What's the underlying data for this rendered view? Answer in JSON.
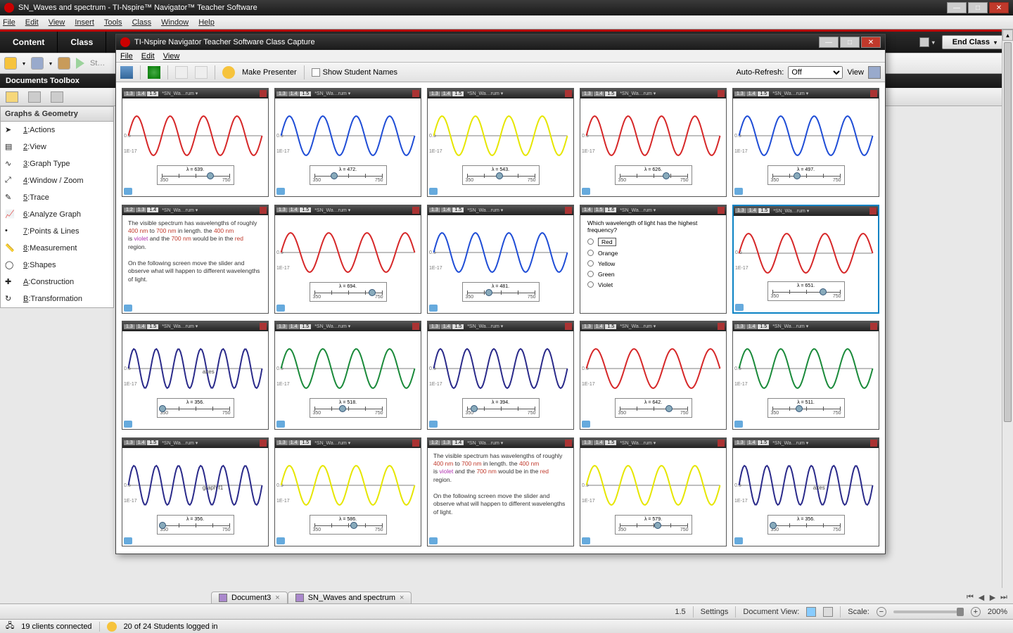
{
  "window": {
    "title": "SN_Waves and spectrum - TI-Nspire™ Navigator™ Teacher Software"
  },
  "menubar": [
    "File",
    "Edit",
    "View",
    "Insert",
    "Tools",
    "Class",
    "Window",
    "Help"
  ],
  "topTabs": [
    "Content",
    "Class"
  ],
  "endClass": "End Class",
  "docbar": "Documents Toolbox",
  "sidebar": {
    "header": "Graphs & Geometry",
    "items": [
      {
        "hot": "1",
        "label": ":Actions"
      },
      {
        "hot": "2",
        "label": ":View"
      },
      {
        "hot": "3",
        "label": ":Graph Type"
      },
      {
        "hot": "4",
        "label": ":Window / Zoom"
      },
      {
        "hot": "5",
        "label": ":Trace"
      },
      {
        "hot": "6",
        "label": ":Analyze Graph"
      },
      {
        "hot": "7",
        "label": ":Points & Lines"
      },
      {
        "hot": "8",
        "label": ":Measurement"
      },
      {
        "hot": "9",
        "label": ":Shapes"
      },
      {
        "hot": "A",
        "label": ":Construction"
      },
      {
        "hot": "B",
        "label": ":Transformation"
      }
    ]
  },
  "capture": {
    "title": "TI-Nspire Navigator Teacher Software Class Capture",
    "menu": [
      "File",
      "Edit",
      "View"
    ],
    "makePresenter": "Make Presenter",
    "showNames": "Show Student Names",
    "autoRefreshLabel": "Auto-Refresh:",
    "autoRefreshValue": "Off",
    "viewLabel": "View",
    "pages": [
      "1.3",
      "1.4",
      "1.5"
    ],
    "docShort": "*SN_Wa…rum",
    "sliderMin": "350",
    "sliderMax": "750",
    "thumbs": [
      {
        "type": "wave",
        "color": "#d62728",
        "lambda": "λ = 639.",
        "freq": 4,
        "knob": 0.72
      },
      {
        "type": "wave",
        "color": "#1f4dd6",
        "lambda": "λ = 472.",
        "freq": 4,
        "knob": 0.3
      },
      {
        "type": "wave",
        "color": "#e6e600",
        "lambda": "λ = 543.",
        "freq": 4,
        "knob": 0.48
      },
      {
        "type": "wave",
        "color": "#d62728",
        "lambda": "λ = 626.",
        "freq": 4,
        "knob": 0.69
      },
      {
        "type": "wave",
        "color": "#1f4dd6",
        "lambda": "λ = 497.",
        "freq": 4,
        "knob": 0.37
      },
      {
        "type": "text",
        "pages": [
          "1.2",
          "1.3",
          "1.4"
        ]
      },
      {
        "type": "wave",
        "color": "#d62728",
        "lambda": "λ = 694.",
        "freq": 3.5,
        "knob": 0.86
      },
      {
        "type": "wave",
        "color": "#1f4dd6",
        "lambda": "λ = 481.",
        "freq": 4,
        "knob": 0.33
      },
      {
        "type": "quiz",
        "pages": [
          "1.4",
          "1.5",
          "1.6"
        ],
        "q": "Which wavelength of light has the highest frequency?",
        "opts": [
          "Red",
          "Orange",
          "Yellow",
          "Green",
          "Violet"
        ],
        "sel": 0
      },
      {
        "type": "wave",
        "color": "#d62728",
        "lambda": "λ = 651.",
        "freq": 3.5,
        "knob": 0.75,
        "selected": true
      },
      {
        "type": "wave",
        "color": "#2a2a8a",
        "lambda": "λ = 356.",
        "freq": 6,
        "knob": 0.02,
        "annot": "axes"
      },
      {
        "type": "wave",
        "color": "#1a8a3a",
        "lambda": "λ = 518.",
        "freq": 4,
        "knob": 0.42
      },
      {
        "type": "wave",
        "color": "#2a2a8a",
        "lambda": "λ = 394.",
        "freq": 5,
        "knob": 0.11
      },
      {
        "type": "wave",
        "color": "#d62728",
        "lambda": "λ = 642.",
        "freq": 3.5,
        "knob": 0.73
      },
      {
        "type": "wave",
        "color": "#1a8a3a",
        "lambda": "λ = 511.",
        "freq": 4,
        "knob": 0.4
      },
      {
        "type": "wave",
        "color": "#2a2a8a",
        "lambda": "λ = 356.",
        "freq": 6,
        "knob": 0.02,
        "annot": "graph f1"
      },
      {
        "type": "wave",
        "color": "#e6e600",
        "lambda": "λ = 586.",
        "freq": 4,
        "knob": 0.59
      },
      {
        "type": "text",
        "pages": [
          "1.2",
          "1.3",
          "1.4"
        ]
      },
      {
        "type": "wave",
        "color": "#e6e600",
        "lambda": "λ = 579.",
        "freq": 4,
        "knob": 0.57
      },
      {
        "type": "wave",
        "color": "#2a2a8a",
        "lambda": "λ = 356.",
        "freq": 6,
        "knob": 0.02,
        "annot": "axes"
      }
    ],
    "textcard": {
      "line1a": "The visible spectrum has wavelengths of roughly ",
      "v400": "400 nm",
      "to": " to ",
      "v700": "700 nm",
      "line1b": " in length.  the ",
      "line2a": " is ",
      "violet": "violet",
      "line2b": " and the ",
      "line2c": " would be in the ",
      "red": "red",
      "line2d": " region.",
      "line3": "On the following screen move the slider and observe what will happen to different wavelengths of light."
    }
  },
  "doctabs": [
    {
      "label": "Document3"
    },
    {
      "label": "SN_Waves and spectrum"
    }
  ],
  "status": {
    "pageNum": "1.5",
    "settings": "Settings",
    "docView": "Document View:",
    "scale": "Scale:",
    "zoom": "200%",
    "clients": "19 clients connected",
    "students": "20 of 24 Students logged in"
  }
}
